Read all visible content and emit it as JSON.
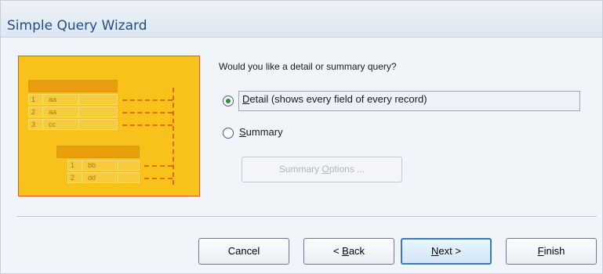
{
  "window": {
    "title": "Simple Query Wizard"
  },
  "illustration": {
    "table1": [
      {
        "num": "1",
        "val": "aa"
      },
      {
        "num": "2",
        "val": "aa"
      },
      {
        "num": "3",
        "val": "cc"
      }
    ],
    "table2": [
      {
        "num": "1",
        "val": "bb"
      },
      {
        "num": "2",
        "val": "dd"
      }
    ],
    "colors": {
      "background": "#f8c21b",
      "border": "#e05a1f",
      "header": "#e99f0c",
      "dashes": "#e26a18"
    }
  },
  "question": "Would you like a detail or summary query?",
  "options": [
    {
      "pre": "",
      "accel": "D",
      "post": "etail (shows every field of every record)",
      "selected": true
    },
    {
      "pre": "",
      "accel": "S",
      "post": "ummary",
      "selected": false
    }
  ],
  "summary_options": {
    "pre": "Summary ",
    "accel": "O",
    "post": "ptions ...",
    "enabled": false
  },
  "buttons": {
    "cancel": {
      "pre": "Cancel",
      "accel": "",
      "post": ""
    },
    "back": {
      "pre": "< ",
      "accel": "B",
      "post": "ack"
    },
    "next": {
      "pre": "",
      "accel": "N",
      "post": "ext >"
    },
    "finish": {
      "pre": "",
      "accel": "F",
      "post": "inish"
    }
  },
  "icons": {
    "selected_radio": "radio-checked-icon",
    "unselected_radio": "radio-unchecked-icon"
  },
  "accent_color": "#1f4e8c"
}
